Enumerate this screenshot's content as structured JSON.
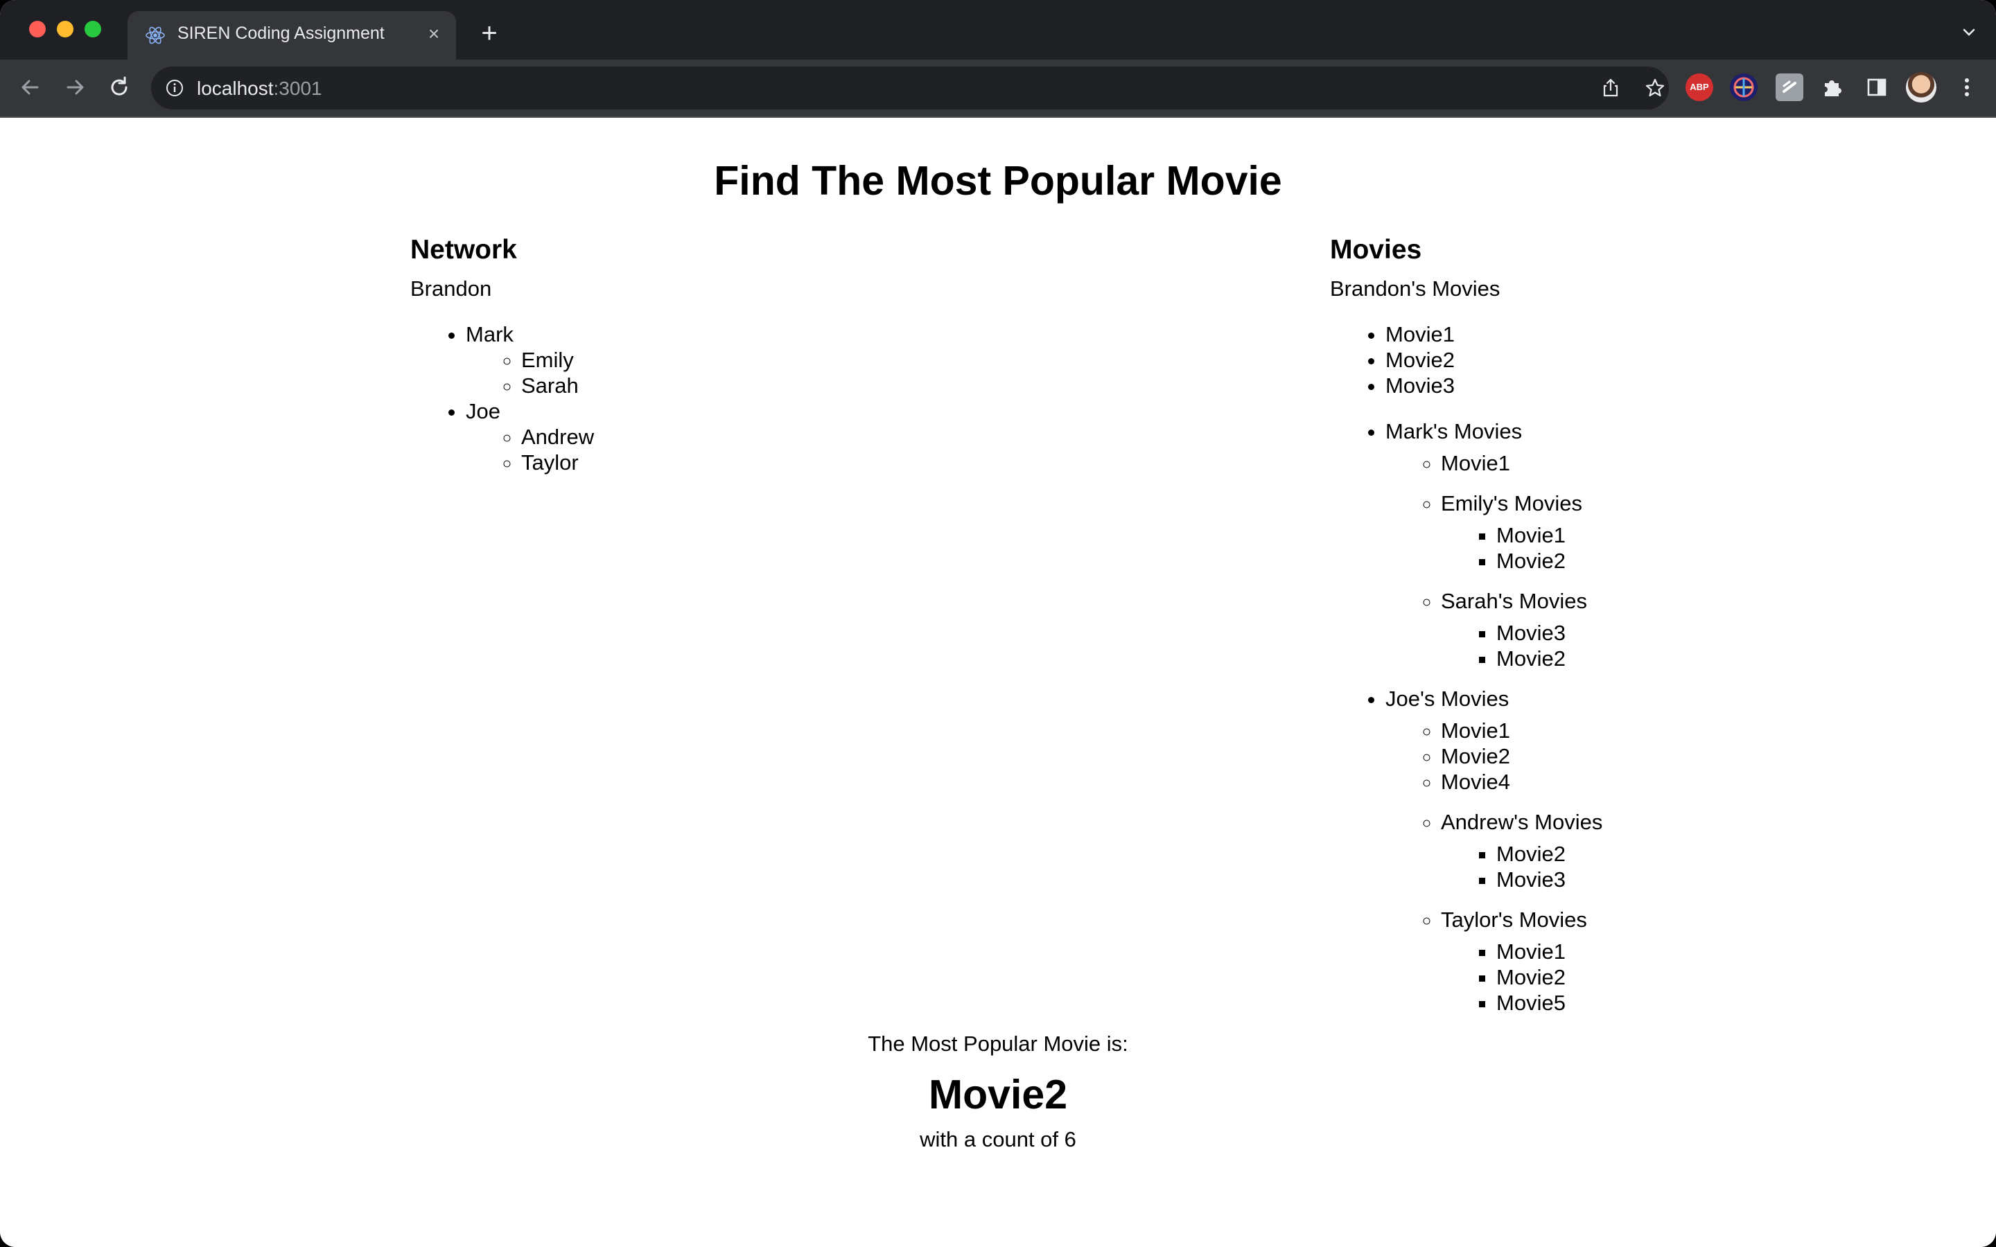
{
  "browser": {
    "tab_title": "SIREN Coding Assignment",
    "tab_close": "×",
    "new_tab": "+",
    "url_host": "localhost",
    "url_port": ":3001",
    "extensions": [
      "adblock-plus-icon",
      "globe-extension-icon",
      "square-extension-icon",
      "puzzle-icon",
      "sidepanel-icon"
    ],
    "abp_label": "ABP"
  },
  "page": {
    "title": "Find The Most Popular Movie",
    "network": {
      "heading": "Network",
      "root": "Brandon",
      "friends": [
        {
          "name": "Mark",
          "friends": [
            "Emily",
            "Sarah"
          ]
        },
        {
          "name": "Joe",
          "friends": [
            "Andrew",
            "Taylor"
          ]
        }
      ]
    },
    "movies": {
      "heading": "Movies",
      "root_label": "Brandon's Movies",
      "root_movies": [
        "Movie1",
        "Movie2",
        "Movie3"
      ],
      "friends": [
        {
          "label": "Mark's Movies",
          "movies": [
            "Movie1"
          ],
          "friends": [
            {
              "label": "Emily's Movies",
              "movies": [
                "Movie1",
                "Movie2"
              ]
            },
            {
              "label": "Sarah's Movies",
              "movies": [
                "Movie3",
                "Movie2"
              ]
            }
          ]
        },
        {
          "label": "Joe's Movies",
          "movies": [
            "Movie1",
            "Movie2",
            "Movie4"
          ],
          "friends": [
            {
              "label": "Andrew's Movies",
              "movies": [
                "Movie2",
                "Movie3"
              ]
            },
            {
              "label": "Taylor's Movies",
              "movies": [
                "Movie1",
                "Movie2",
                "Movie5"
              ]
            }
          ]
        }
      ]
    },
    "result": {
      "label": "The Most Popular Movie is:",
      "movie": "Movie2",
      "count_text": "with a count of 6"
    }
  }
}
